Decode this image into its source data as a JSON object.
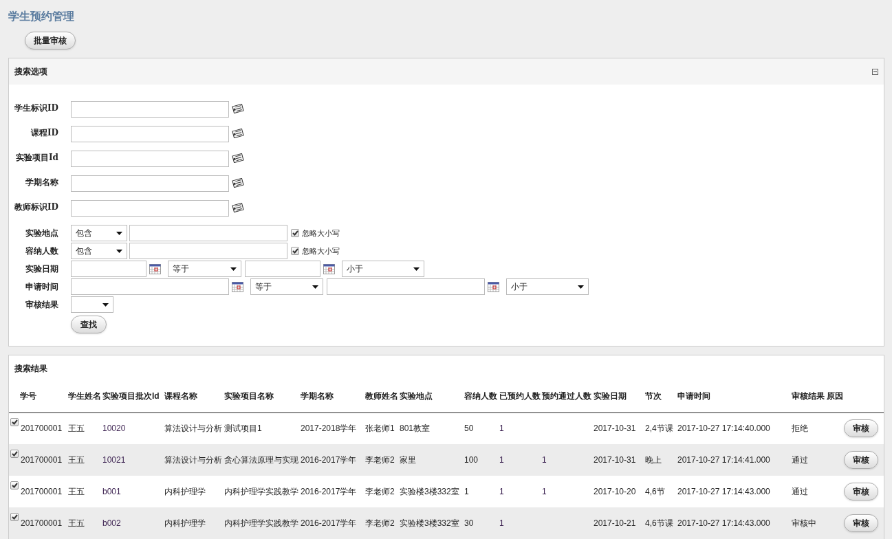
{
  "page_title": "学生预约管理",
  "toolbar": {
    "batch_button": "批量审核"
  },
  "search_panel": {
    "title": "搜索选项",
    "expanded": true,
    "fields": [
      {
        "kind": "lookup",
        "label": "学生标识ID"
      },
      {
        "kind": "lookup",
        "label": "课程ID"
      },
      {
        "kind": "lookup",
        "label": "实验项目Id"
      },
      {
        "kind": "lookup",
        "label": "学期名称"
      },
      {
        "kind": "lookup",
        "label": "教师标识ID"
      },
      {
        "kind": "text_op",
        "label": "实验地点",
        "operator": "包含",
        "ignore_case": {
          "label": "忽略大小写",
          "checked": true
        }
      },
      {
        "kind": "text_op",
        "label": "容纳人数",
        "operator": "包含",
        "ignore_case": {
          "label": "忽略大小写",
          "checked": true
        }
      },
      {
        "kind": "date",
        "label": "实验日期",
        "from_operator": "等于",
        "to_operator": "小于"
      },
      {
        "kind": "datetime",
        "label": "申请时间",
        "from_operator": "等于",
        "to_operator": "小于"
      },
      {
        "kind": "select",
        "label": "审核结果"
      }
    ],
    "search_button": "查找"
  },
  "results_panel": {
    "title": "搜索结果",
    "columns": [
      "学号",
      "学生姓名",
      "实验项目批次Id",
      "课程名称",
      "实验项目名称",
      "学期名称",
      "教师姓名",
      "实验地点",
      "容纳人数",
      "已预约人数",
      "预约通过人数",
      "实验日期",
      "节次",
      "申请时间",
      "审核结果",
      "原因"
    ],
    "rows": [
      {
        "checked": true,
        "cells": [
          "201700001",
          "王五",
          "10020",
          "算法设计与分析",
          "测试项目1",
          "2017-2018学年",
          "张老师1",
          "801教室",
          "50",
          "1",
          null,
          "2017-10-31",
          "2,4节课",
          "2017-10-27 17:14:40.000",
          "拒绝",
          null
        ],
        "action": "审核"
      },
      {
        "checked": true,
        "cells": [
          "201700001",
          "王五",
          "10021",
          "算法设计与分析",
          "贪心算法原理与实现",
          "2016-2017学年",
          "李老师2",
          "家里",
          "100",
          "1",
          "1",
          "2017-10-31",
          "晚上",
          "2017-10-27 17:14:41.000",
          "通过",
          null
        ],
        "action": "审核"
      },
      {
        "checked": true,
        "cells": [
          "201700001",
          "王五",
          "b001",
          "内科护理学",
          "内科护理学实践教学",
          "2016-2017学年",
          "李老师2",
          "实验楼3楼332室",
          "1",
          "1",
          "1",
          "2017-10-20",
          "4,6节",
          "2017-10-27 17:14:43.000",
          "通过",
          null
        ],
        "action": "审核"
      },
      {
        "checked": true,
        "cells": [
          "201700001",
          "王五",
          "b002",
          "内科护理学",
          "内科护理学实践教学",
          "2016-2017学年",
          "李老师2",
          "实验楼3楼332室",
          "30",
          "1",
          null,
          "2017-10-21",
          "4,6节课",
          "2017-10-27 17:14:43.000",
          "审核中",
          null
        ],
        "action": "审核"
      }
    ]
  }
}
